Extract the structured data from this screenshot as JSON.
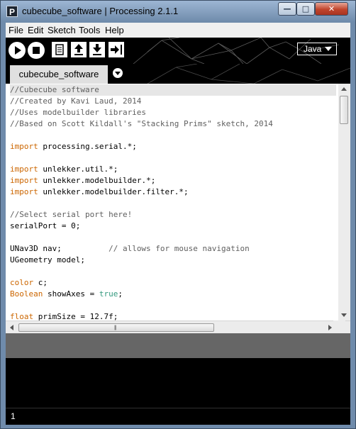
{
  "window": {
    "title": "cubecube_software | Processing 2.1.1",
    "app_icon_letter": "P",
    "controls": {
      "minimize": "—",
      "maximize": "□",
      "close": "✕"
    }
  },
  "menu": [
    "File",
    "Edit",
    "Sketch",
    "Tools",
    "Help"
  ],
  "toolbar": {
    "buttons": [
      "run-icon",
      "stop-icon",
      "new-icon",
      "open-icon",
      "save-icon",
      "export-icon"
    ],
    "mode": "Java"
  },
  "tabs": [
    {
      "label": "cubecube_software",
      "active": true
    }
  ],
  "editor": {
    "lines": [
      [
        [
          "c",
          "//Cubecube software"
        ]
      ],
      [
        [
          "c",
          "//Created by Kavi Laud, 2014"
        ]
      ],
      [
        [
          "c",
          "//Uses modelbuilder libraries"
        ]
      ],
      [
        [
          "c",
          "//Based on Scott Kildall's \"Stacking Prims\" sketch, 2014"
        ]
      ],
      [],
      [
        [
          "k",
          "import"
        ],
        [
          "t",
          " processing.serial.*;"
        ]
      ],
      [],
      [
        [
          "k",
          "import"
        ],
        [
          "t",
          " unlekker.util.*;"
        ]
      ],
      [
        [
          "k",
          "import"
        ],
        [
          "t",
          " unlekker.modelbuilder.*;"
        ]
      ],
      [
        [
          "k",
          "import"
        ],
        [
          "t",
          " unlekker.modelbuilder.filter.*;"
        ]
      ],
      [],
      [
        [
          "c",
          "//Select serial port here!"
        ]
      ],
      [
        [
          "t",
          "serialPort = 0;"
        ]
      ],
      [],
      [
        [
          "t",
          "UNav3D nav;          "
        ],
        [
          "c",
          "// allows for mouse navigation"
        ]
      ],
      [
        [
          "t",
          "UGeometry model;"
        ]
      ],
      [],
      [
        [
          "k",
          "color"
        ],
        [
          "t",
          " c;"
        ]
      ],
      [
        [
          "k",
          "Boolean"
        ],
        [
          "t",
          " showAxes = "
        ],
        [
          "l",
          "true"
        ],
        [
          "t",
          ";"
        ]
      ],
      [],
      [
        [
          "k",
          "float"
        ],
        [
          "t",
          " primSize = 12.7f;"
        ]
      ]
    ]
  },
  "scroll": {
    "vertical_grip": "≡",
    "horizontal_grip": "|||"
  },
  "status": {
    "line_number": "1"
  },
  "colors": {
    "comment": "#5f5f5f",
    "keyword": "#cc6600",
    "literal": "#33997e",
    "toolbar_bg": "#000000",
    "tab_bg": "#e0e0e0"
  }
}
